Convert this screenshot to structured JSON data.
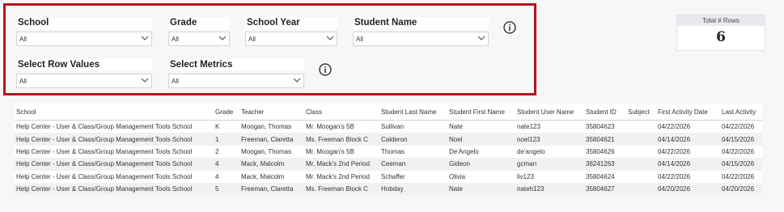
{
  "filters": [
    {
      "id": "school",
      "label": "School",
      "value": "All"
    },
    {
      "id": "grade",
      "label": "Grade",
      "value": "All"
    },
    {
      "id": "school-year",
      "label": "School Year",
      "value": "All"
    },
    {
      "id": "student-name",
      "label": "Student Name",
      "value": "All"
    },
    {
      "id": "row-values",
      "label": "Select Row Values",
      "value": "All"
    },
    {
      "id": "metrics",
      "label": "Select Metrics",
      "value": "All"
    }
  ],
  "kpi": {
    "label": "Total # Rows",
    "value": "6"
  },
  "table": {
    "headers": [
      "School",
      "Grade",
      "Teacher",
      "Class",
      "Student Last Name",
      "Student First Name",
      "Student User Name",
      "Student ID",
      "Subject",
      "First Activity Date",
      "Last Activity"
    ],
    "rows": [
      [
        "Help Center - User & Class/Group Management Tools School",
        "K",
        "Moogan, Thomas",
        "Mr. Moogan's 5B",
        "Sullivan",
        "Nate",
        "nate123",
        "35804623",
        "",
        "04/22/2026",
        "04/22/2026"
      ],
      [
        "Help Center - User & Class/Group Management Tools School",
        "1",
        "Freeman, Claretta",
        "Ms. Freeman Block C",
        "Calderon",
        "Noel",
        "noel123",
        "35804621",
        "",
        "04/14/2026",
        "04/15/2026"
      ],
      [
        "Help Center - User & Class/Group Management Tools School",
        "2",
        "Moogan, Thomas",
        "Mr. Moogan's 5B",
        "Thomas",
        "De'Angelo",
        "de'angelo",
        "35804626",
        "",
        "04/22/2026",
        "04/22/2026"
      ],
      [
        "Help Center - User & Class/Group Management Tools School",
        "4",
        "Mack, Malcolm",
        "Mr. Mack's 2nd Period",
        "Ceeman",
        "Gideon",
        "gcman",
        "38241263",
        "",
        "04/14/2026",
        "04/15/2026"
      ],
      [
        "Help Center - User & Class/Group Management Tools School",
        "4",
        "Mack, Malcolm",
        "Mr. Mack's 2nd Period",
        "Schaffer",
        "Olivia",
        "liv123",
        "35804624",
        "",
        "04/22/2026",
        "04/22/2026"
      ],
      [
        "Help Center - User & Class/Group Management Tools School",
        "5",
        "Freeman, Claretta",
        "Ms. Freeman Block C",
        "Hobday",
        "Nate",
        "nateh123",
        "35804627",
        "",
        "04/20/2026",
        "04/20/2026"
      ]
    ]
  }
}
